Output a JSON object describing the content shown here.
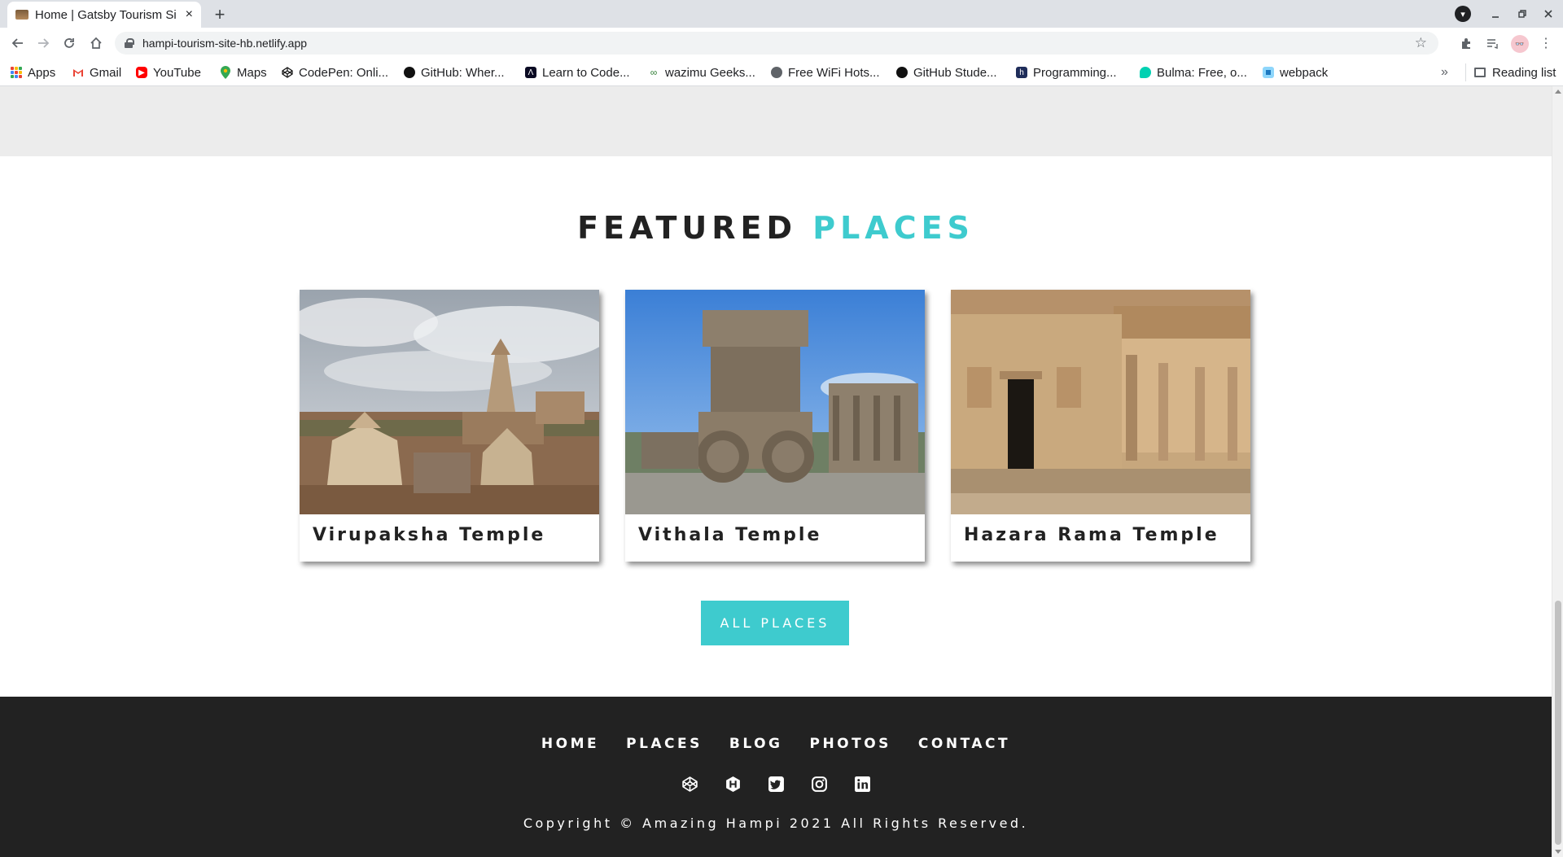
{
  "browser": {
    "tab_title": "Home | Gatsby Tourism Si",
    "tab_close": "×",
    "new_tab": "+",
    "url": "hampi-tourism-site-hb.netlify.app",
    "reading_list": "Reading list",
    "overflow": "»",
    "bookmarks": [
      {
        "label": "Apps",
        "icon": "apps-grid-icon"
      },
      {
        "label": "Gmail",
        "icon": "gmail-icon",
        "color": "#ea4335"
      },
      {
        "label": "YouTube",
        "icon": "youtube-icon",
        "color": "#ff0000"
      },
      {
        "label": "Maps",
        "icon": "maps-icon",
        "color": "#34a853"
      },
      {
        "label": "CodePen: Onli...",
        "icon": "codepen-icon",
        "color": "#111111"
      },
      {
        "label": "GitHub: Wher...",
        "icon": "github-icon",
        "color": "#111111"
      },
      {
        "label": "Learn to Code...",
        "icon": "freecodecamp-icon",
        "color": "#0a0a23"
      },
      {
        "label": "wazimu Geeks...",
        "icon": "wazimu-icon",
        "color": "#2e7d32"
      },
      {
        "label": "Free WiFi Hots...",
        "icon": "globe-icon",
        "color": "#5f6368"
      },
      {
        "label": "GitHub Stude...",
        "icon": "github-icon",
        "color": "#111111"
      },
      {
        "label": "Programming...",
        "icon": "hashnode-h-icon",
        "color": "#1f2d5a"
      },
      {
        "label": "Bulma: Free, o...",
        "icon": "bulma-icon",
        "color": "#00d1b2"
      },
      {
        "label": "webpack",
        "icon": "webpack-icon",
        "color": "#1c78c0"
      }
    ]
  },
  "featured": {
    "title_main": "FEATURED",
    "title_accent": "PLACES",
    "accent_color": "#3ecbce",
    "places": [
      {
        "name": "Virupaksha Temple"
      },
      {
        "name": "Vithala Temple"
      },
      {
        "name": "Hazara Rama Temple"
      }
    ],
    "button_label": "ALL PLACES"
  },
  "footer": {
    "links": [
      "HOME",
      "PLACES",
      "BLOG",
      "PHOTOS",
      "CONTACT"
    ],
    "socials": [
      "codepen-icon",
      "hashnode-icon",
      "twitter-icon",
      "instagram-icon",
      "linkedin-icon"
    ],
    "copyright": "Copyright © Amazing Hampi 2021 All Rights Reserved.",
    "background": "#222222"
  }
}
